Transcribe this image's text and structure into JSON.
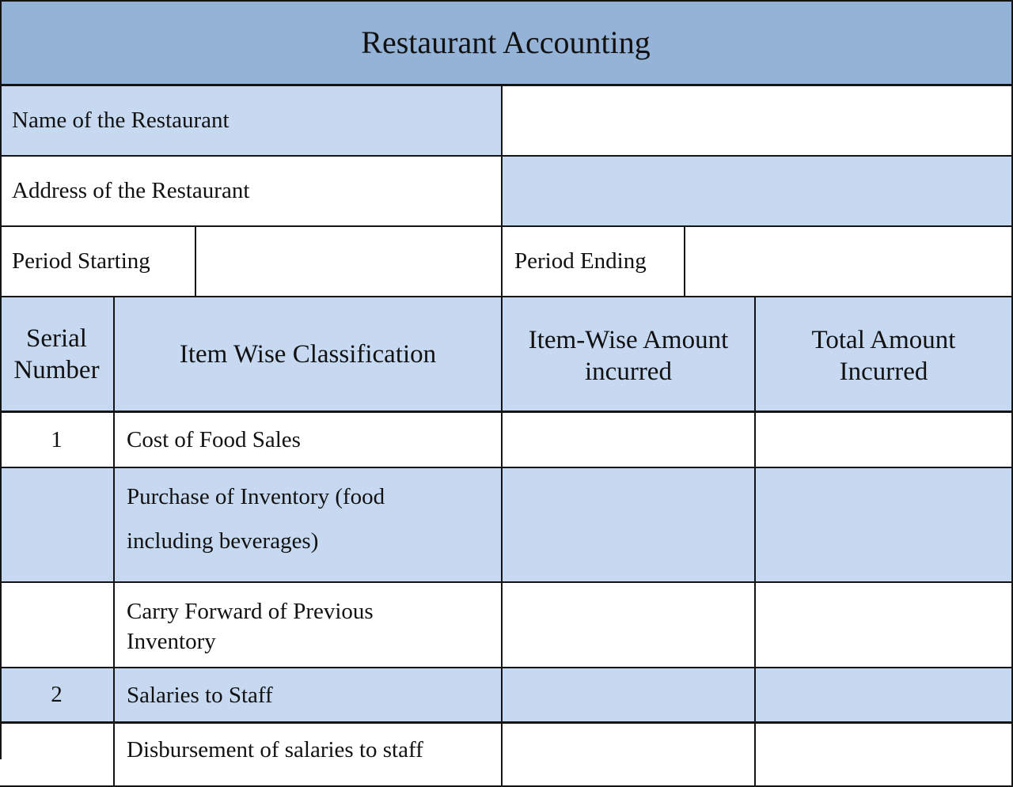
{
  "form": {
    "title": "Restaurant Accounting",
    "fields": {
      "name_label": "Name of the Restaurant",
      "name_value": "",
      "address_label": "Address of the Restaurant",
      "address_value": "",
      "period_start_label": "Period Starting",
      "period_start_value": "",
      "period_end_label": "Period Ending",
      "period_end_value": ""
    },
    "table": {
      "headers": [
        "Serial\nNumber",
        "Item Wise Classification",
        "Item-Wise Amount incurred",
        "Total Amount Incurred"
      ],
      "header_serial_line1": "Serial",
      "header_serial_line2": "Number",
      "header_item": "Item Wise Classification",
      "header_itemwise_line1": "Item-Wise Amount",
      "header_itemwise_line2": "incurred",
      "header_total_line1": "Total Amount",
      "header_total_line2": "Incurred",
      "rows": [
        {
          "serial": "1",
          "item": "Cost of Food Sales",
          "item_amount": "",
          "total_amount": ""
        },
        {
          "serial": "",
          "item_line1": "Purchase of Inventory (food",
          "item_line2": "including beverages)",
          "item_amount": "",
          "total_amount": ""
        },
        {
          "serial": "",
          "item_line1": "Carry Forward of Previous",
          "item_line2": "Inventory",
          "item_amount": "",
          "total_amount": ""
        },
        {
          "serial": "2",
          "item": "Salaries to Staff",
          "item_amount": "",
          "total_amount": ""
        },
        {
          "serial": "",
          "item": "Disbursement of salaries to staff",
          "item_amount": "",
          "total_amount": ""
        }
      ]
    },
    "colors": {
      "title_bg": "#95b3d7",
      "shaded_bg": "#c6d9f1",
      "border": "#141414"
    }
  }
}
